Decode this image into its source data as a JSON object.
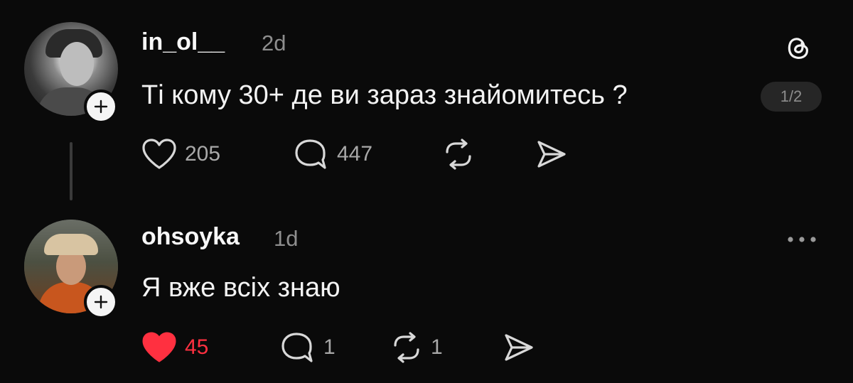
{
  "posts": [
    {
      "username": "in_ol__",
      "time": "2d",
      "text": "Ті кому 30+ де ви зараз знайомитесь ?",
      "page_indicator": "1/2",
      "likes": "205",
      "replies": "447",
      "liked": false
    },
    {
      "username": "ohsoyka",
      "time": "1d",
      "text": "Я вже всіх знаю",
      "likes": "45",
      "replies": "1",
      "reposts": "1",
      "liked": true
    }
  ],
  "colors": {
    "background": "#0a0a0a",
    "liked_red": "#ff3040",
    "muted": "#8e8e8e"
  },
  "icons": [
    "threads-logo-icon",
    "plus-icon",
    "heart-icon",
    "comment-icon",
    "repost-icon",
    "share-icon",
    "more-icon"
  ]
}
